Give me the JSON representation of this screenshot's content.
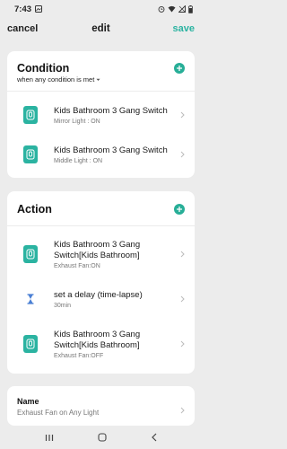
{
  "status": {
    "time": "7:43"
  },
  "header": {
    "cancel": "cancel",
    "title": "edit",
    "save": "save"
  },
  "condition": {
    "title": "Condition",
    "match": "when any condition is met",
    "items": [
      {
        "title": "Kids Bathroom 3 Gang Switch",
        "detail": "Mirror Light : ON",
        "icon": "switch-icon"
      },
      {
        "title": "Kids Bathroom 3 Gang Switch",
        "detail": "Middle Light : ON",
        "icon": "switch-icon"
      }
    ]
  },
  "action": {
    "title": "Action",
    "items": [
      {
        "title": "Kids Bathroom 3 Gang Switch[Kids Bathroom]",
        "detail": "Exhaust Fan:ON",
        "icon": "switch-icon"
      },
      {
        "title": "set a delay (time-lapse)",
        "detail": "30min",
        "icon": "hourglass-icon"
      },
      {
        "title": "Kids Bathroom 3 Gang Switch[Kids Bathroom]",
        "detail": "Exhaust Fan:OFF",
        "icon": "switch-icon"
      }
    ]
  },
  "name": {
    "label": "Name",
    "value": "Exhaust Fan on Any Light"
  },
  "colors": {
    "accent": "#2bb3a1",
    "background": "#ececec",
    "card": "#ffffff"
  }
}
